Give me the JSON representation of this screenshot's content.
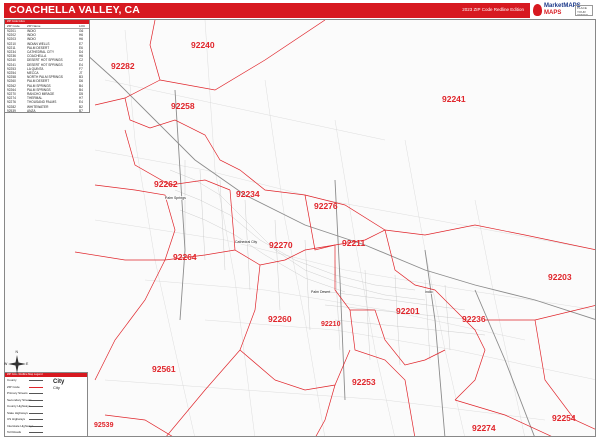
{
  "header": {
    "title": "COACHELLA VALLEY, CA",
    "edition": "2023 ZIP Code Redline Edition"
  },
  "logo": {
    "main": "MarketMAPS",
    "sub": "MAPS",
    "tag": "PLACE YOUR ORDER"
  },
  "colors": {
    "brand_red": "#d71920",
    "zip_label": "#e0252b",
    "boundary_red": "#e0252b",
    "road_gray": "#9a9a9a"
  },
  "index": {
    "heading": "ZIP Code Index",
    "columns": [
      "ZIP Code",
      "ZIP Name",
      "LOC"
    ],
    "rows": [
      [
        "92201",
        "INDIO",
        "G6"
      ],
      [
        "92202",
        "INDIO",
        "H6"
      ],
      [
        "92203",
        "INDIO",
        "H6"
      ],
      [
        "92210",
        "INDIAN WELLS",
        "E7"
      ],
      [
        "92211",
        "PALM DESERT",
        "E6"
      ],
      [
        "92234",
        "CATHEDRAL CITY",
        "D4"
      ],
      [
        "92236",
        "COACHELLA",
        "H6"
      ],
      [
        "92240",
        "DESERT HOT SPRINGS",
        "C2"
      ],
      [
        "92241",
        "DESERT HOT SPRINGS",
        "E4"
      ],
      [
        "92253",
        "LA QUINTA",
        "F7"
      ],
      [
        "92254",
        "MECCA",
        "J7"
      ],
      [
        "92258",
        "NORTH PALM SPRINGS",
        "B3"
      ],
      [
        "92260",
        "PALM DESERT",
        "D6"
      ],
      [
        "92262",
        "PALM SPRINGS",
        "B4"
      ],
      [
        "92264",
        "PALM SPRINGS",
        "B4"
      ],
      [
        "92270",
        "RANCHO MIRAGE",
        "D5"
      ],
      [
        "92274",
        "THERMAL",
        "H7"
      ],
      [
        "92276",
        "THOUSAND PALMS",
        "E4"
      ],
      [
        "92282",
        "WHITEWATER",
        "B2"
      ],
      [
        "92539",
        "ANZA",
        "B7"
      ],
      [
        "92561",
        "MOUNTAIN CENTER",
        "C6"
      ]
    ]
  },
  "zip_labels": [
    {
      "code": "92240",
      "size": "lg"
    },
    {
      "code": "92282",
      "size": "lg"
    },
    {
      "code": "92241",
      "size": "lg"
    },
    {
      "code": "92258",
      "size": "lg"
    },
    {
      "code": "92262",
      "size": "lg"
    },
    {
      "code": "92234",
      "size": "lg"
    },
    {
      "code": "92276",
      "size": "lg"
    },
    {
      "code": "92270",
      "size": "lg"
    },
    {
      "code": "92211",
      "size": "lg"
    },
    {
      "code": "92264",
      "size": "lg"
    },
    {
      "code": "92203",
      "size": "lg"
    },
    {
      "code": "92201",
      "size": "lg"
    },
    {
      "code": "92236",
      "size": "lg"
    },
    {
      "code": "92260",
      "size": "lg"
    },
    {
      "code": "92210",
      "size": "sm"
    },
    {
      "code": "92253",
      "size": "lg"
    },
    {
      "code": "92561",
      "size": "lg"
    },
    {
      "code": "92274",
      "size": "lg"
    },
    {
      "code": "92254",
      "size": "lg"
    },
    {
      "code": "92539",
      "size": "sm"
    }
  ],
  "cities": [
    "Palm Springs",
    "Cathedral City",
    "Palm Desert",
    "Indio"
  ],
  "legend": {
    "heading": "ZIP Code Redline Map Legend",
    "rows": [
      "County",
      "ZIP Code",
      "Primary Streets",
      "Secondary Streets",
      "County Highways",
      "State Highways",
      "US Highways",
      "Interstate Highways",
      "Toll Roads"
    ],
    "city_big": "City",
    "city_sm": "City"
  },
  "compass": {
    "n": "N",
    "s": "S",
    "e": "E",
    "w": "W"
  }
}
